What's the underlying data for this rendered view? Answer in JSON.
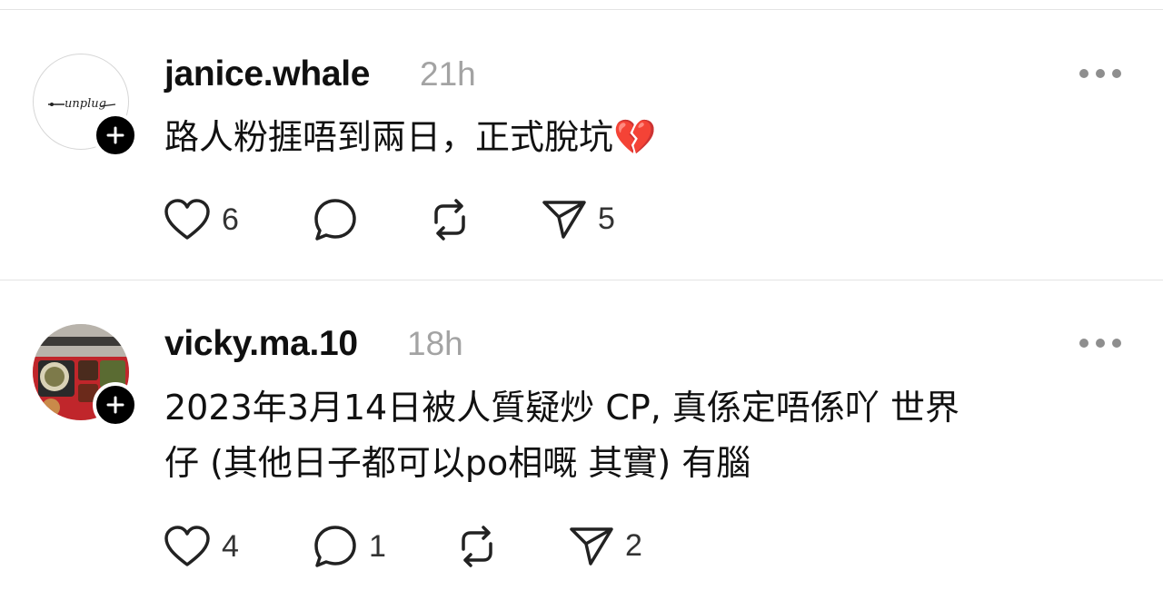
{
  "posts": [
    {
      "username": "janice.whale",
      "time": "21h",
      "avatar_text": "unplug",
      "text": "路人粉捱唔到兩日，正式脫坑💔",
      "likes": "6",
      "replies": "",
      "reposts": "",
      "shares": "5"
    },
    {
      "username": "vicky.ma.10",
      "time": "18h",
      "text_line1": "2023年3月14日被人質疑炒 CP, 真係定唔係吖 世界",
      "text_line2": "仔 (其他日子都可以po相嘅 其實) 有腦",
      "likes": "4",
      "replies": "1",
      "reposts": "",
      "shares": "2"
    }
  ],
  "icons": {
    "like": "heart-icon",
    "reply": "comment-icon",
    "repost": "repost-icon",
    "share": "send-icon",
    "more": "more-icon",
    "follow": "plus-icon"
  }
}
